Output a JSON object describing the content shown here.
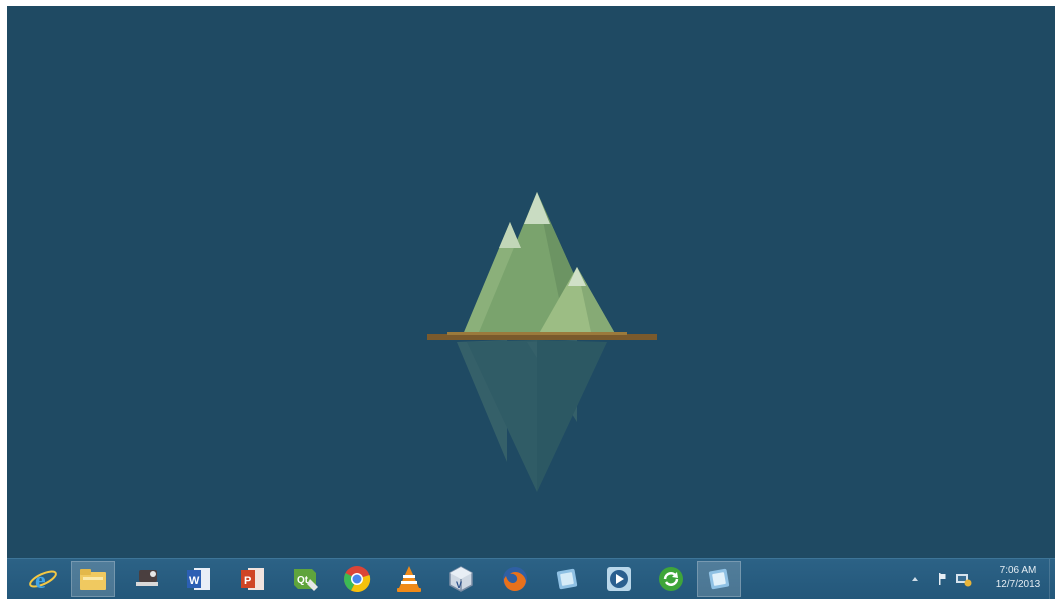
{
  "desktop": {
    "background_color": "#1f4a63"
  },
  "taskbar": {
    "pinned_apps": [
      {
        "name": "Internet Explorer",
        "icon": "internet-explorer-icon"
      },
      {
        "name": "File Explorer",
        "icon": "file-explorer-icon"
      },
      {
        "name": "Image viewer",
        "icon": "image-viewer-icon"
      },
      {
        "name": "Microsoft Word",
        "icon": "word-icon"
      },
      {
        "name": "Microsoft PowerPoint",
        "icon": "powerpoint-icon"
      },
      {
        "name": "Qt Creator",
        "icon": "qt-creator-icon"
      },
      {
        "name": "Google Chrome",
        "icon": "chrome-icon"
      },
      {
        "name": "VLC media player",
        "icon": "vlc-icon"
      },
      {
        "name": "VirtualBox",
        "icon": "virtualbox-icon"
      },
      {
        "name": "Firefox",
        "icon": "firefox-icon"
      },
      {
        "name": "Application",
        "icon": "app-window-icon"
      },
      {
        "name": "Media player",
        "icon": "media-player-icon"
      },
      {
        "name": "Update utility",
        "icon": "update-icon"
      },
      {
        "name": "Active window",
        "icon": "active-window-icon"
      }
    ],
    "tray": {
      "overflow_arrow": "show-hidden-icons-icon",
      "icons": [
        "flag-icon",
        "network-icon"
      ],
      "clock_time": "7:06 AM",
      "clock_date": "12/7/2013"
    }
  }
}
